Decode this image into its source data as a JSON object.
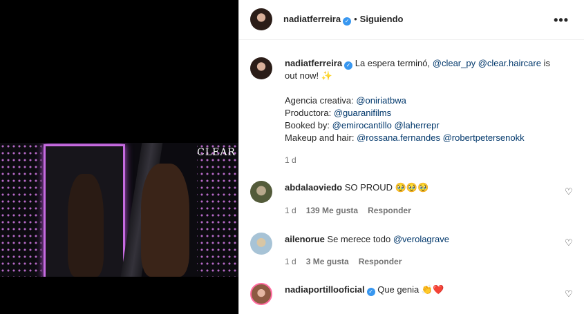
{
  "post": {
    "username": "nadiatferreira",
    "follow_state": "Siguiendo",
    "more_icon": "more-options-icon",
    "verified_icon": "verified-badge-icon",
    "media_logo": "CLEAR"
  },
  "caption": {
    "username": "nadiatferreira",
    "text_1": "La espera terminó,",
    "mention_1": "@clear_py",
    "mention_2": "@clear.haircare",
    "text_2": "is",
    "line2_text": "out now!",
    "sparkle": "✨",
    "agency_label": "Agencia creativa:",
    "agency_mention": "@oniriatbwa",
    "producer_label": "Productora:",
    "producer_mention": "@guaranifilms",
    "booked_label": "Booked by:",
    "booked_mention_1": "@emirocantillo",
    "booked_mention_2": "@laherrepr",
    "makeup_label": "Makeup and hair:",
    "makeup_mention_1": "@rossana.fernandes",
    "makeup_mention_2": "@robertpetersenokk",
    "time": "1 d"
  },
  "comments": [
    {
      "username": "abdalaoviedo",
      "text": "SO PROUD",
      "emojis": "🥹🥹🥹",
      "time": "1 d",
      "likes": "139 Me gusta",
      "reply": "Responder"
    },
    {
      "username": "ailenorue",
      "text": "Se merece todo",
      "mention": "@verolagrave",
      "time": "1 d",
      "likes": "3 Me gusta",
      "reply": "Responder"
    },
    {
      "username": "nadiaportillooficial",
      "text": "Que genia",
      "emojis": "👏❤️"
    }
  ],
  "icons": {
    "heart": "♡",
    "more": "•••",
    "check": "✓"
  }
}
